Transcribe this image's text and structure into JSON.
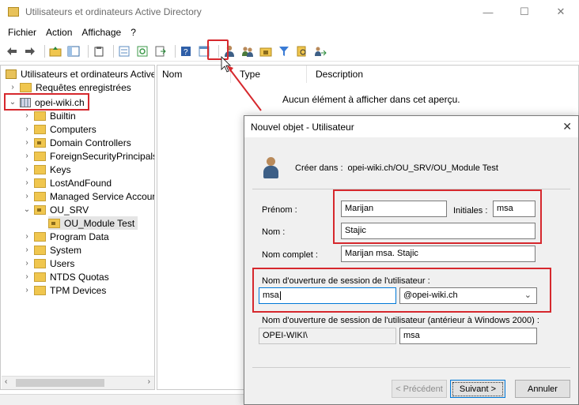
{
  "window": {
    "title": "Utilisateurs et ordinateurs Active Directory",
    "minimize": "—",
    "maximize": "☐",
    "close": "✕"
  },
  "menu": [
    "Fichier",
    "Action",
    "Affichage",
    "?"
  ],
  "toolbar_icons": [
    "back-arrow-icon",
    "forward-arrow-icon",
    "folder-up-icon",
    "console-tree-icon",
    "clipboard-icon",
    "list-icon",
    "refresh-icon",
    "export-icon",
    "help-icon",
    "properties-icon",
    "new-user-icon",
    "new-group-icon",
    "new-ou-icon",
    "filter-icon",
    "find-icon",
    "delegate-icon"
  ],
  "tree": {
    "root_label": "Utilisateurs et ordinateurs Active",
    "saved_queries": "Requêtes enregistrées",
    "domain": "opei-wiki.ch",
    "items": [
      "Builtin",
      "Computers",
      "Domain Controllers",
      "ForeignSecurityPrincipals",
      "Keys",
      "LostAndFound",
      "Managed Service Accour",
      "OU_SRV"
    ],
    "ou_child": "OU_Module Test",
    "items_after": [
      "Program Data",
      "System",
      "Users",
      "NTDS Quotas",
      "TPM Devices"
    ]
  },
  "list": {
    "columns": [
      "Nom",
      "Type",
      "Description"
    ],
    "empty_message": "Aucun élément à afficher dans cet aperçu."
  },
  "dialog": {
    "title": "Nouvel objet - Utilisateur",
    "create_in_label": "Créer dans :",
    "create_in_path": "opei-wiki.ch/OU_SRV/OU_Module Test",
    "first_name_label": "Prénom :",
    "first_name_value": "Marijan",
    "initials_label": "Initiales :",
    "initials_value": "msa",
    "last_name_label": "Nom :",
    "last_name_value": "Stajic",
    "full_name_label": "Nom complet :",
    "full_name_value": "Marijan msa. Stajic",
    "logon_label": "Nom d'ouverture de session de l'utilisateur :",
    "logon_value": "msa",
    "logon_domain": "@opei-wiki.ch",
    "pre2000_label": "Nom d'ouverture de session de l'utilisateur (antérieur à Windows 2000) :",
    "pre2000_domain": "OPEI-WIKI\\",
    "pre2000_value": "msa",
    "btn_back": "< Précédent",
    "btn_next": "Suivant >",
    "btn_cancel": "Annuler"
  },
  "colors": {
    "highlight_red": "#d6282d",
    "folder_yellow": "#f0c64e",
    "focus_blue": "#0078d7"
  }
}
